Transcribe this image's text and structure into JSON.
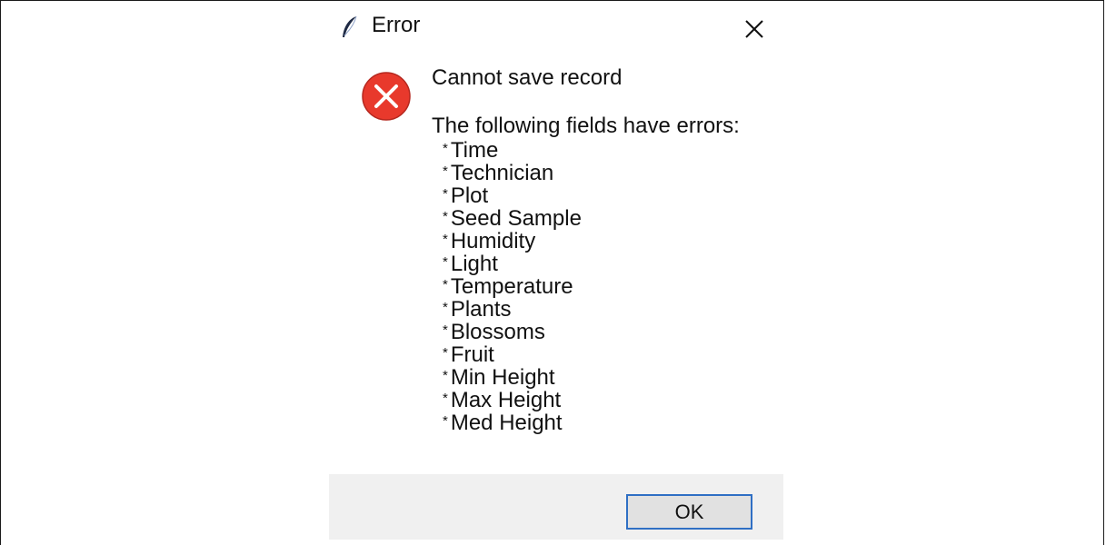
{
  "window": {
    "title": "Error",
    "app_icon": "feather-icon",
    "close_icon": "close-icon"
  },
  "message": {
    "icon": "error-icon",
    "main": "Cannot save record",
    "detail_header": "The following fields have errors:",
    "bullet": "*",
    "fields": [
      "Time",
      "Technician",
      "Plot",
      "Seed Sample",
      "Humidity",
      "Light",
      "Temperature",
      "Plants",
      "Blossoms",
      "Fruit",
      "Min Height",
      "Max Height",
      "Med Height"
    ]
  },
  "buttons": {
    "ok_label": "OK"
  },
  "colors": {
    "error_red": "#e8392c",
    "button_focus_border": "#2f6fc4",
    "button_bar_bg": "#f0f0f0",
    "button_bg": "#e1e1e1"
  }
}
